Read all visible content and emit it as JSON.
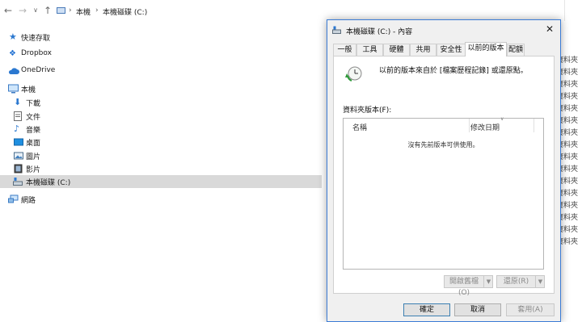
{
  "explorer": {
    "breadcrumb": [
      "本機",
      "本機磁碟 (C:)"
    ],
    "nav": [
      {
        "label": "快速存取",
        "icon": "star-icon"
      },
      {
        "label": "Dropbox",
        "icon": "dropbox-icon"
      },
      {
        "label": "OneDrive",
        "icon": "cloud-icon"
      },
      {
        "label": "本機",
        "icon": "computer-icon"
      },
      {
        "label": "下載",
        "icon": "download-icon"
      },
      {
        "label": "文件",
        "icon": "document-icon"
      },
      {
        "label": "音樂",
        "icon": "music-icon"
      },
      {
        "label": "桌面",
        "icon": "desktop-icon"
      },
      {
        "label": "圖片",
        "icon": "pictures-icon"
      },
      {
        "label": "影片",
        "icon": "video-icon"
      },
      {
        "label": "本機磁碟 (C:)",
        "icon": "drive-icon"
      },
      {
        "label": "網路",
        "icon": "network-icon"
      }
    ],
    "behind_label": "資料夾"
  },
  "dialog": {
    "title": "本機磁碟 (C:) - 內容",
    "tabs": [
      "一般",
      "工具",
      "硬體",
      "共用",
      "安全性",
      "以前的版本",
      "配額"
    ],
    "active_tab": "以前的版本",
    "info": "以前的版本來自於 [檔案歷程記錄] 或還原點。",
    "folder_versions_label": "資料夾版本(F):",
    "columns": [
      "名稱",
      "修改日期"
    ],
    "empty_message": "沒有先前版本可供使用。",
    "open_button": "開啟舊檔(O)",
    "restore_button": "還原(R)",
    "ok_button": "確定",
    "cancel_button": "取消",
    "apply_button": "套用(A)"
  }
}
